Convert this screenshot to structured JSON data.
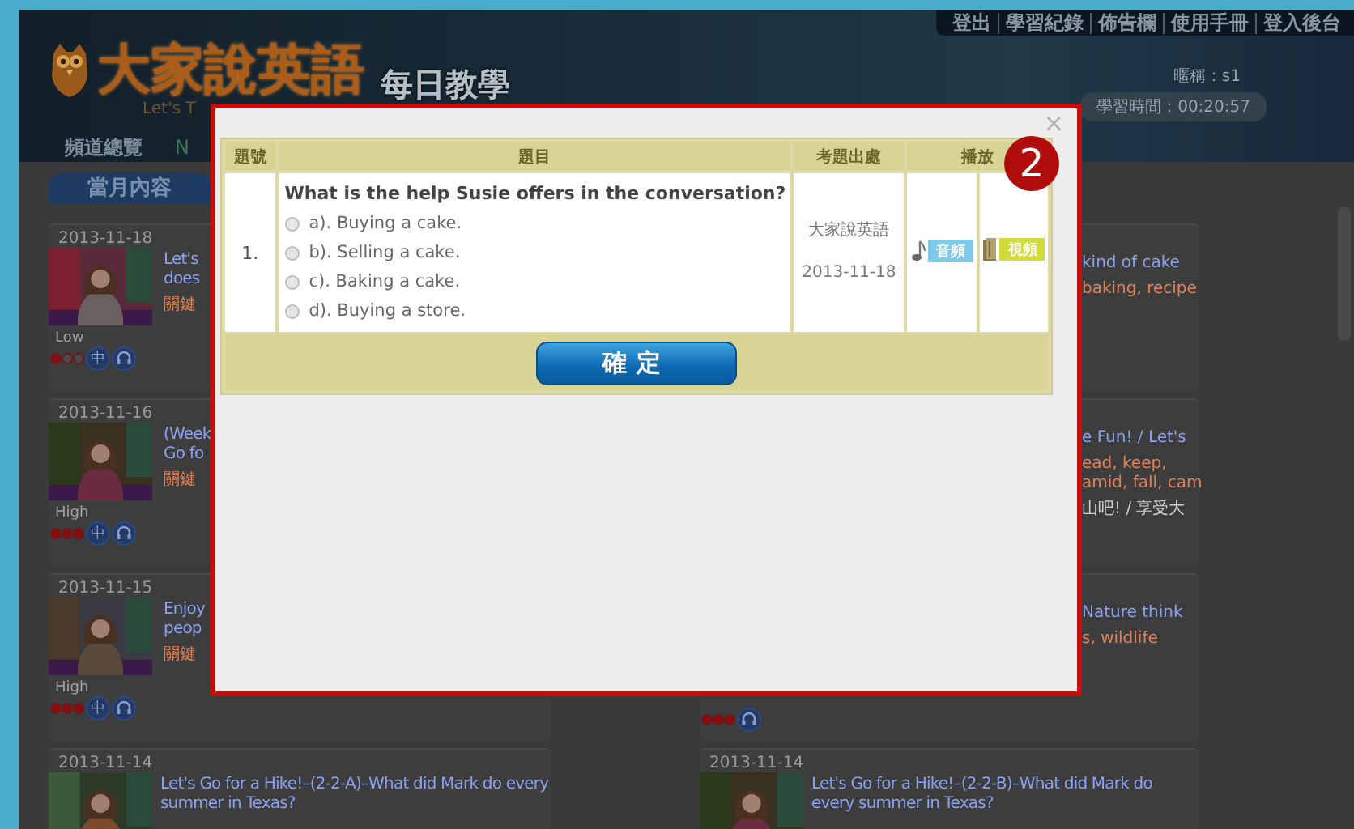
{
  "header": {
    "logo": "大家說英語",
    "tagline": "Let's T",
    "section": "每日教學",
    "links": [
      "登出",
      "學習紀錄",
      "佈告欄",
      "使用手冊",
      "登入後台"
    ],
    "nickname": "暱稱：s1",
    "study_time": "學習時間：00:20:57"
  },
  "nav": [
    "頻道總覽",
    "N"
  ],
  "month_tab": "當月內容",
  "left_column": [
    {
      "kind": "full",
      "date": "2013-11-18",
      "title_lines": [
        "Let's",
        "does"
      ],
      "keyword_lines": [
        "關鍵"
      ],
      "level_label": "Low",
      "stars": 1,
      "badge": "中"
    },
    {
      "kind": "full",
      "date": "2013-11-16",
      "title_lines": [
        "(Week",
        "Go fo"
      ],
      "keyword_lines": [
        "關鍵"
      ],
      "level_label": "High",
      "stars": 3,
      "badge": "中"
    },
    {
      "kind": "full",
      "date": "2013-11-15",
      "title_lines": [
        "Enjoy",
        "peop"
      ],
      "keyword_lines": [
        "關鍵"
      ],
      "level_label": "High",
      "stars": 3,
      "badge": "中"
    },
    {
      "kind": "full",
      "date": "2013-11-14",
      "title_lines": [
        "Let's Go for a Hike!–(2-2-A)–What did Mark do every summer in Texas?"
      ]
    }
  ],
  "right_column": [
    {
      "kind": "covered",
      "title_lines": [
        "kind of cake"
      ],
      "keyword_lines": [
        "baking, recipe"
      ]
    },
    {
      "kind": "covered",
      "title_lines": [
        "e Fun! / Let's"
      ],
      "keyword_lines": [
        "ead, keep,",
        "amid, fall, cam"
      ],
      "summary": "山吧! / 享受大"
    },
    {
      "kind": "covered",
      "title_lines": [
        "Nature think"
      ],
      "keyword_lines": [
        "s, wildlife"
      ],
      "stars": 3
    },
    {
      "kind": "full",
      "date": "2013-11-14",
      "title_lines": [
        "Let's Go for a Hike!–(2-2-B)–What did Mark do every summer in Texas?"
      ]
    }
  ],
  "dialog": {
    "close": "×",
    "columns": [
      "題號",
      "題目",
      "考題出處",
      "播放"
    ],
    "questions": [
      {
        "number": "1.",
        "question": "What is the help Susie offers in the conversation?",
        "options": [
          {
            "label": "a). Buying a cake.",
            "selected": false
          },
          {
            "label": "b). Selling a cake.",
            "selected": false
          },
          {
            "label": "c). Baking a cake.",
            "selected": false
          },
          {
            "label": "d). Buying a store.",
            "selected": false
          }
        ],
        "source": "大家說英語",
        "source_date": "2013-11-18",
        "audio_button": "音頻",
        "video_button": "視頻"
      }
    ],
    "confirm": "確定"
  },
  "step_badge": "2"
}
